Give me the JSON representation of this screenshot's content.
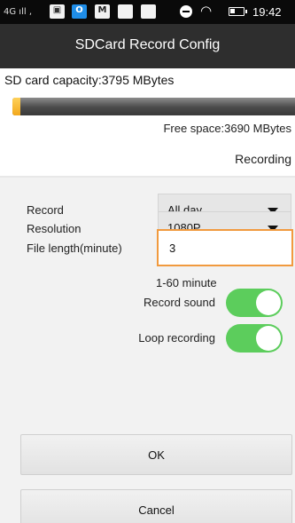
{
  "status_bar": {
    "network": "4G",
    "time": "19:42",
    "icons": [
      "signal-icon",
      "gallery-icon",
      "outlook-icon",
      "email-icon",
      "app-icon",
      "app-icon",
      "minus-circle-icon",
      "wifi-icon",
      "battery-icon"
    ]
  },
  "header": {
    "title": "SDCard Record Config"
  },
  "storage": {
    "capacity_label": "SD card capacity:3795 MBytes",
    "used_fraction": 0.028,
    "free_label": "Free space:3690 MBytes",
    "status": "Recording"
  },
  "settings": {
    "record": {
      "label": "Record",
      "value": "All day"
    },
    "resolution": {
      "label": "Resolution",
      "value": "1080P"
    },
    "file_length": {
      "label": "File length(minute)",
      "value": "3",
      "hint": "1-60 minute"
    },
    "record_sound": {
      "label": "Record sound",
      "on": true
    },
    "loop_recording": {
      "label": "Loop recording",
      "on": true
    }
  },
  "buttons": {
    "ok": "OK",
    "cancel": "Cancel"
  },
  "colors": {
    "title_bar": "#2e2e2e",
    "accent_orange": "#f19a3e",
    "toggle_on": "#5ccd5c",
    "progress_used": "#f2a81c"
  }
}
